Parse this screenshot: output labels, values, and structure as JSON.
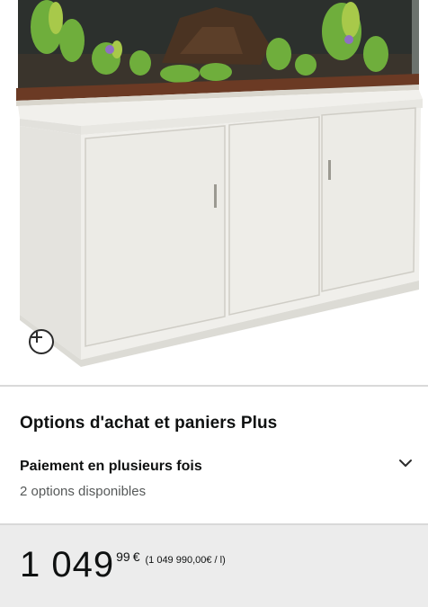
{
  "product_image": {
    "zoom_icon": "plus-circle-icon"
  },
  "purchase_options": {
    "title": "Options d'achat et paniers Plus",
    "installments": {
      "title": "Paiement en plusieurs fois",
      "subtitle": "2 options disponibles",
      "icon": "chevron-down-icon"
    }
  },
  "price": {
    "whole": "1 049",
    "fraction": "99",
    "currency": "€",
    "unit_price": "(1 049 990,00€ / l)"
  }
}
